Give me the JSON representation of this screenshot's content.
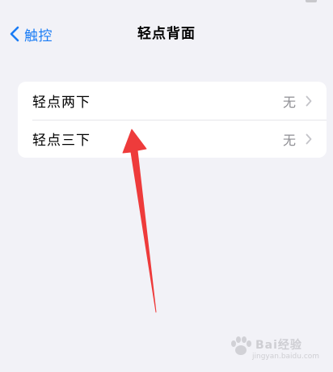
{
  "nav": {
    "back_label": "触控",
    "title": "轻点背面"
  },
  "settings": {
    "rows": [
      {
        "label": "轻点两下",
        "value": "无"
      },
      {
        "label": "轻点三下",
        "value": "无"
      }
    ]
  },
  "watermark": {
    "text": "Bai经验",
    "sub": "jingyan.baidu.com"
  },
  "colors": {
    "accent": "#1a7cf5",
    "background": "#f2f2f7",
    "annotation_arrow": "#ee3b3b"
  },
  "icons": {
    "back": "chevron-left-icon",
    "row_disclosure": "chevron-right-icon",
    "watermark_logo": "paw-icon"
  }
}
